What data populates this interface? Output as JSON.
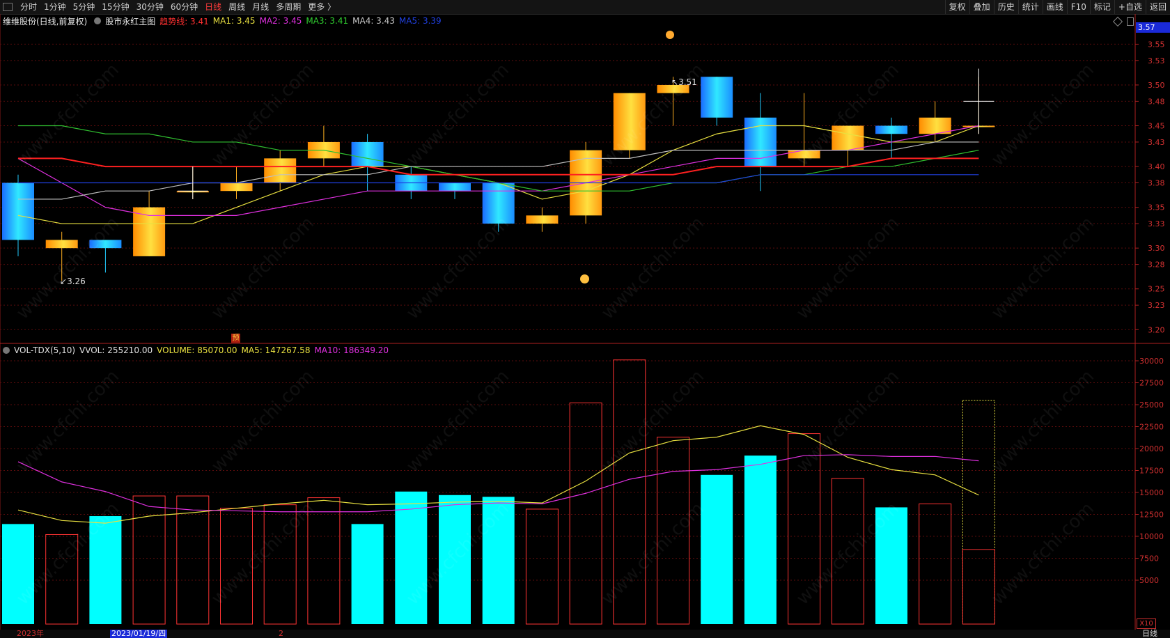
{
  "toolbar": {
    "periods": [
      "分时",
      "1分钟",
      "5分钟",
      "15分钟",
      "30分钟",
      "60分钟",
      "日线",
      "周线",
      "月线",
      "多周期",
      "更多 〉"
    ],
    "active_period": "日线",
    "right_items": [
      "复权",
      "叠加",
      "历史",
      "统计",
      "画线",
      "F10",
      "标记",
      "+自选",
      "返回"
    ]
  },
  "main_info": {
    "stock": "维维股份(日线,前复权)",
    "indicator": "股市永红主图",
    "trend_label": "趋势线: 3.41",
    "ma1": "MA1: 3.45",
    "ma2": "MA2: 3.45",
    "ma3": "MA3: 3.41",
    "ma4": "MA4: 3.43",
    "ma5": "MA5: 3.39"
  },
  "vol_info": {
    "name": "VOL-TDX(5,10)",
    "vvol": "VVOL: 255210.00",
    "volume": "VOLUME: 85070.00",
    "ma5": "MA5: 147267.58",
    "ma10": "MA10: 186349.20"
  },
  "price_axis": [
    "3.55",
    "3.53",
    "3.50",
    "3.48",
    "3.45",
    "3.43",
    "3.40",
    "3.38",
    "3.35",
    "3.33",
    "3.30",
    "3.28",
    "3.25",
    "3.23",
    "3.20"
  ],
  "price_tag": "3.57",
  "vol_axis": [
    "30000",
    "27500",
    "25000",
    "22500",
    "20000",
    "17500",
    "15000",
    "12500",
    "10000",
    "7500",
    "5000"
  ],
  "vol_unit": "X10",
  "annotations": {
    "high": "3.51",
    "low": "3.26",
    "pre": "预"
  },
  "bottom": {
    "year": "2023年",
    "date": "2023/01/19/四",
    "mark": "2",
    "period": "日线"
  },
  "watermark": "www.cfchi.com",
  "colors": {
    "up": "#ffb020",
    "down": "#22ccff",
    "vol_down": "#00ffff",
    "vol_up_border": "#ff3333"
  },
  "chart_data": {
    "type": "candlestick",
    "price_range": [
      3.19,
      3.57
    ],
    "candles": [
      {
        "o": 3.38,
        "c": 3.31,
        "h": 3.39,
        "l": 3.29,
        "v": 11400
      },
      {
        "o": 3.3,
        "c": 3.31,
        "h": 3.32,
        "l": 3.26,
        "v": 10200
      },
      {
        "o": 3.31,
        "c": 3.3,
        "h": 3.31,
        "l": 3.27,
        "v": 12300
      },
      {
        "o": 3.29,
        "c": 3.35,
        "h": 3.37,
        "l": 3.29,
        "v": 14600
      },
      {
        "o": 3.37,
        "c": 3.37,
        "h": 3.4,
        "l": 3.36,
        "v": 14600
      },
      {
        "o": 3.37,
        "c": 3.38,
        "h": 3.4,
        "l": 3.36,
        "v": 13200
      },
      {
        "o": 3.38,
        "c": 3.41,
        "h": 3.42,
        "l": 3.37,
        "v": 13600
      },
      {
        "o": 3.41,
        "c": 3.43,
        "h": 3.45,
        "l": 3.4,
        "v": 14400
      },
      {
        "o": 3.43,
        "c": 3.4,
        "h": 3.44,
        "l": 3.37,
        "v": 11400
      },
      {
        "o": 3.39,
        "c": 3.37,
        "h": 3.4,
        "l": 3.36,
        "v": 15100
      },
      {
        "o": 3.38,
        "c": 3.37,
        "h": 3.38,
        "l": 3.36,
        "v": 14700
      },
      {
        "o": 3.38,
        "c": 3.33,
        "h": 3.38,
        "l": 3.32,
        "v": 14500
      },
      {
        "o": 3.33,
        "c": 3.34,
        "h": 3.35,
        "l": 3.32,
        "v": 13100
      },
      {
        "o": 3.34,
        "c": 3.42,
        "h": 3.43,
        "l": 3.33,
        "v": 25200
      },
      {
        "o": 3.42,
        "c": 3.49,
        "h": 3.49,
        "l": 3.41,
        "v": 30100
      },
      {
        "o": 3.49,
        "c": 3.5,
        "h": 3.51,
        "l": 3.45,
        "v": 21300
      },
      {
        "o": 3.51,
        "c": 3.46,
        "h": 3.51,
        "l": 3.45,
        "v": 17000
      },
      {
        "o": 3.46,
        "c": 3.4,
        "h": 3.49,
        "l": 3.37,
        "v": 19200
      },
      {
        "o": 3.41,
        "c": 3.42,
        "h": 3.49,
        "l": 3.4,
        "v": 21700
      },
      {
        "o": 3.42,
        "c": 3.45,
        "h": 3.45,
        "l": 3.4,
        "v": 16600
      },
      {
        "o": 3.45,
        "c": 3.44,
        "h": 3.46,
        "l": 3.41,
        "v": 13300
      },
      {
        "o": 3.44,
        "c": 3.46,
        "h": 3.48,
        "l": 3.43,
        "v": 13700
      },
      {
        "o": 3.45,
        "c": 3.45,
        "h": 3.51,
        "l": 3.44,
        "v": 8500
      }
    ],
    "lines": [
      {
        "name": "ma-yellow",
        "color": "#e8e040",
        "values": [
          3.34,
          3.33,
          3.33,
          3.33,
          3.33,
          3.35,
          3.37,
          3.39,
          3.4,
          3.4,
          3.39,
          3.38,
          3.36,
          3.37,
          3.39,
          3.42,
          3.44,
          3.45,
          3.45,
          3.44,
          3.43,
          3.43,
          3.45
        ]
      },
      {
        "name": "ma-magenta",
        "color": "#e030e0",
        "values": [
          3.41,
          3.38,
          3.35,
          3.34,
          3.34,
          3.34,
          3.35,
          3.36,
          3.37,
          3.37,
          3.37,
          3.37,
          3.37,
          3.38,
          3.39,
          3.4,
          3.41,
          3.41,
          3.42,
          3.42,
          3.43,
          3.44,
          3.45
        ]
      },
      {
        "name": "ma-green",
        "color": "#30c030",
        "values": [
          3.45,
          3.45,
          3.44,
          3.44,
          3.43,
          3.43,
          3.42,
          3.42,
          3.41,
          3.4,
          3.39,
          3.38,
          3.37,
          3.37,
          3.37,
          3.38,
          3.38,
          3.39,
          3.39,
          3.4,
          3.4,
          3.41,
          3.42
        ]
      },
      {
        "name": "ma-white",
        "color": "#c0c0c0",
        "values": [
          3.36,
          3.36,
          3.37,
          3.37,
          3.38,
          3.38,
          3.39,
          3.39,
          3.39,
          3.4,
          3.4,
          3.4,
          3.4,
          3.41,
          3.41,
          3.42,
          3.42,
          3.42,
          3.42,
          3.42,
          3.42,
          3.43,
          3.43
        ]
      },
      {
        "name": "trend-red",
        "color": "#ff2020",
        "values": [
          3.41,
          3.41,
          3.4,
          3.4,
          3.4,
          3.4,
          3.4,
          3.4,
          3.4,
          3.39,
          3.39,
          3.39,
          3.39,
          3.39,
          3.39,
          3.39,
          3.4,
          3.4,
          3.4,
          3.4,
          3.41,
          3.41,
          3.41
        ]
      },
      {
        "name": "ma-blue",
        "color": "#2040e0",
        "values": [
          3.38,
          3.38,
          3.38,
          3.38,
          3.38,
          3.38,
          3.38,
          3.38,
          3.38,
          3.38,
          3.38,
          3.38,
          3.38,
          3.38,
          3.38,
          3.38,
          3.38,
          3.39,
          3.39,
          3.39,
          3.39,
          3.39,
          3.39
        ]
      }
    ],
    "vol_range": [
      0,
      30000
    ],
    "vol_ma5": [
      13000,
      11800,
      11500,
      12300,
      12700,
      13200,
      13700,
      14100,
      13600,
      13700,
      13900,
      14000,
      13800,
      16300,
      19500,
      20900,
      21300,
      22600,
      21600,
      19000,
      17600,
      17000,
      14700
    ],
    "vol_ma10": [
      18500,
      16200,
      15100,
      13400,
      13000,
      12900,
      12800,
      12800,
      12800,
      13100,
      13600,
      13800,
      13700,
      14900,
      16500,
      17400,
      17600,
      18200,
      19200,
      19300,
      19100,
      19100,
      18600
    ]
  }
}
